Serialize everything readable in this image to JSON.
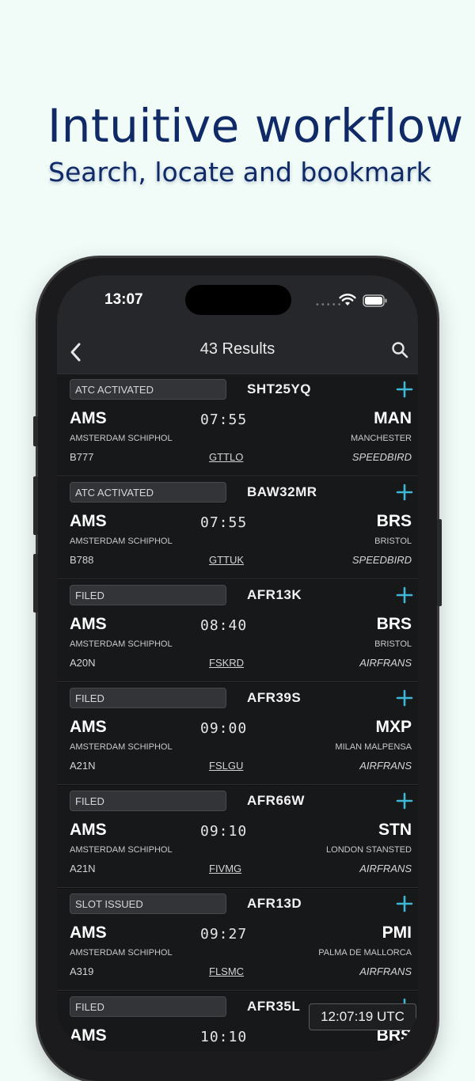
{
  "hero": {
    "title": "Intuitive workflow",
    "subtitle": "Search, locate and bookmark"
  },
  "status_bar": {
    "time": "13:07"
  },
  "navbar": {
    "title": "43 Results",
    "back_icon": "chevron-left-icon",
    "search_icon": "search-icon"
  },
  "colors": {
    "accent": "#3fb8d6",
    "title": "#0f2a66",
    "background": "#f1fbf7"
  },
  "results": [
    {
      "status": "ATC ACTIVATED",
      "callsign": "SHT25YQ",
      "origin": "AMS",
      "origin_name": "AMSTERDAM SCHIPHOL",
      "time": "07:55",
      "destination": "MAN",
      "destination_name": "MANCHESTER",
      "aircraft": "B777",
      "registration": "GTTLO",
      "airline": "SPEEDBIRD"
    },
    {
      "status": "ATC ACTIVATED",
      "callsign": "BAW32MR",
      "origin": "AMS",
      "origin_name": "AMSTERDAM SCHIPHOL",
      "time": "07:55",
      "destination": "BRS",
      "destination_name": "BRISTOL",
      "aircraft": "B788",
      "registration": "GTTUK",
      "airline": "SPEEDBIRD"
    },
    {
      "status": "FILED",
      "callsign": "AFR13K",
      "origin": "AMS",
      "origin_name": "AMSTERDAM SCHIPHOL",
      "time": "08:40",
      "destination": "BRS",
      "destination_name": "BRISTOL",
      "aircraft": "A20N",
      "registration": "FSKRD",
      "airline": "AIRFRANS"
    },
    {
      "status": "FILED",
      "callsign": "AFR39S",
      "origin": "AMS",
      "origin_name": "AMSTERDAM SCHIPHOL",
      "time": "09:00",
      "destination": "MXP",
      "destination_name": "MILAN MALPENSA",
      "aircraft": "A21N",
      "registration": "FSLGU",
      "airline": "AIRFRANS"
    },
    {
      "status": "FILED",
      "callsign": "AFR66W",
      "origin": "AMS",
      "origin_name": "AMSTERDAM SCHIPHOL",
      "time": "09:10",
      "destination": "STN",
      "destination_name": "LONDON STANSTED",
      "aircraft": "A21N",
      "registration": "FIVMG",
      "airline": "AIRFRANS"
    },
    {
      "status": "SLOT ISSUED",
      "callsign": "AFR13D",
      "origin": "AMS",
      "origin_name": "AMSTERDAM SCHIPHOL",
      "time": "09:27",
      "destination": "PMI",
      "destination_name": "PALMA DE MALLORCA",
      "aircraft": "A319",
      "registration": "FLSMC",
      "airline": "AIRFRANS"
    },
    {
      "status": "FILED",
      "callsign": "AFR35L",
      "origin": "AMS",
      "origin_name": "",
      "time": "10:10",
      "destination": "BRS",
      "destination_name": "",
      "aircraft": "",
      "registration": "",
      "airline": ""
    }
  ],
  "utc_clock": "12:07:19 UTC"
}
